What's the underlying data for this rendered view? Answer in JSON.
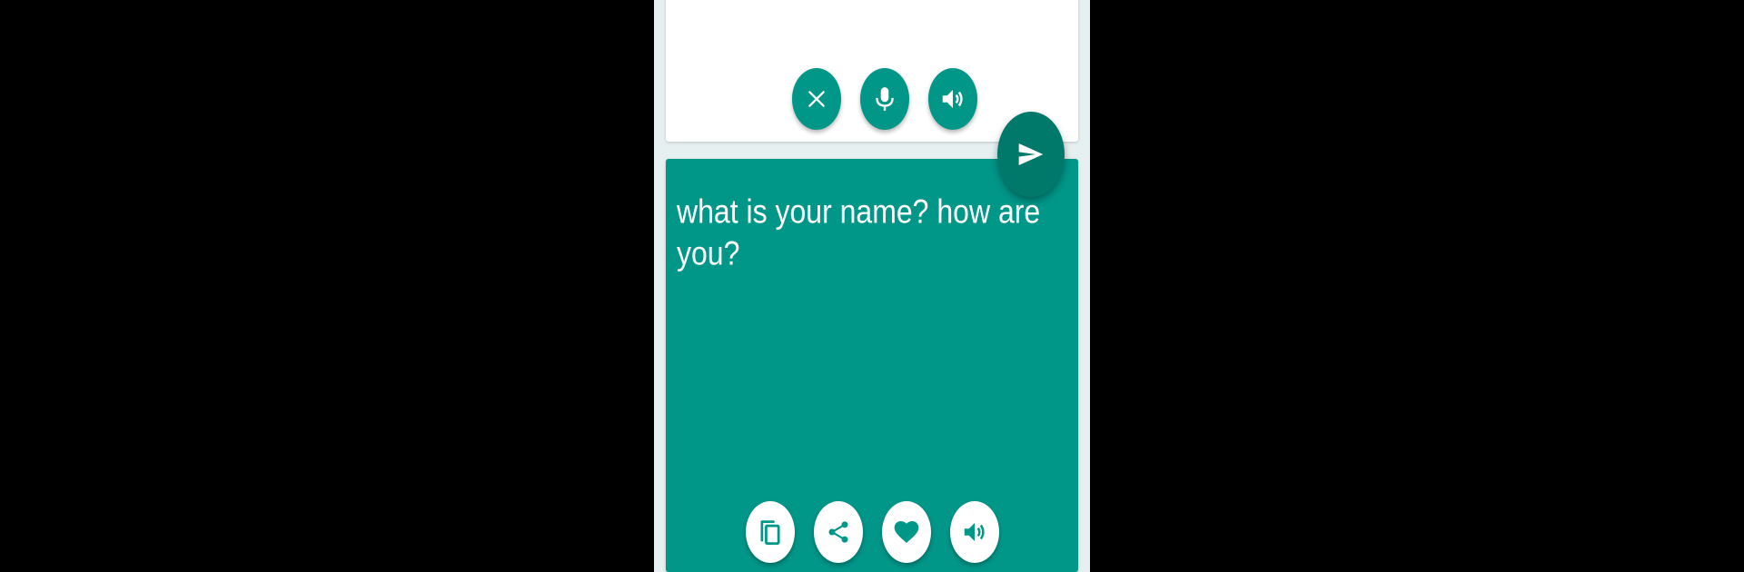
{
  "input_panel": {
    "buttons": [
      {
        "name": "clear-button",
        "icon": "close-icon"
      },
      {
        "name": "microphone-button",
        "icon": "microphone-icon"
      },
      {
        "name": "speak-input-button",
        "icon": "volume-icon"
      }
    ]
  },
  "send_button": {
    "icon": "send-icon"
  },
  "output_panel": {
    "text": "what is your name? how are you?",
    "buttons": [
      {
        "name": "copy-button",
        "icon": "copy-icon"
      },
      {
        "name": "share-button",
        "icon": "share-icon"
      },
      {
        "name": "favorite-button",
        "icon": "heart-icon"
      },
      {
        "name": "speak-output-button",
        "icon": "volume-icon"
      }
    ]
  },
  "colors": {
    "primary": "#009688",
    "primary_dark": "#00796b",
    "background": "#e6f0f1",
    "card": "#ffffff"
  }
}
